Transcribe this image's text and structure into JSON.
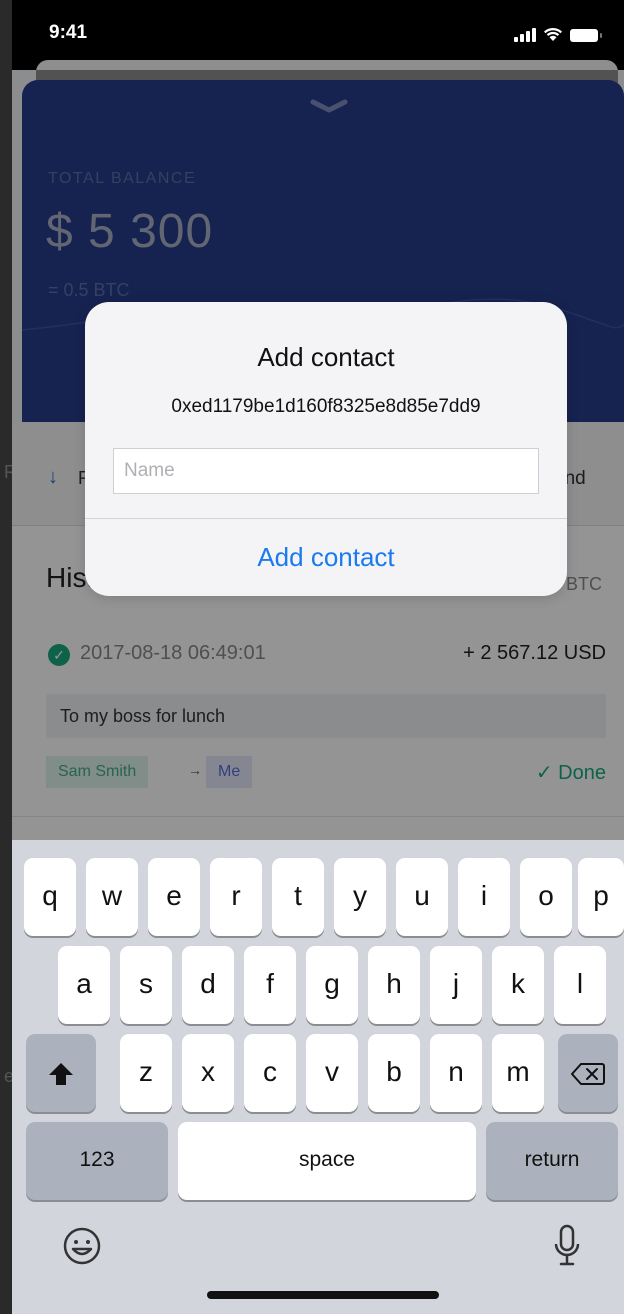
{
  "status_bar": {
    "time": "9:41"
  },
  "balance": {
    "label": "TOTAL BALANCE",
    "amount": "$ 5 300",
    "btc": "= 0.5 BTC"
  },
  "actions": {
    "receive_partial": "R",
    "send_partial": "end"
  },
  "history": {
    "title": "History",
    "btc_tag": "BTC",
    "transaction": {
      "date": "2017-08-18 06:49:01",
      "amount": "+ 2 567.12 USD",
      "note": "To my boss for lunch",
      "from": "Sam Smith",
      "to": "Me",
      "status": "✓ Done"
    }
  },
  "alert": {
    "title": "Add contact",
    "address": "0xed1179be1d160f8325e8d85e7dd9",
    "name_placeholder": "Name",
    "button_label": "Add contact"
  },
  "keyboard": {
    "row1": [
      "q",
      "w",
      "e",
      "r",
      "t",
      "y",
      "u",
      "i",
      "o",
      "p"
    ],
    "row2": [
      "a",
      "s",
      "d",
      "f",
      "g",
      "h",
      "j",
      "k",
      "l"
    ],
    "row3": [
      "z",
      "x",
      "c",
      "v",
      "b",
      "n",
      "m"
    ],
    "numbers_key": "123",
    "space_key": "space",
    "return_key": "return"
  },
  "colors": {
    "balance_card": "#263b8a",
    "accent_blue": "#1a7af0",
    "success_green": "#1aa980"
  }
}
